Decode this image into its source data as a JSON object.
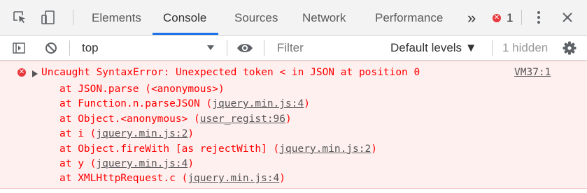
{
  "colors": {
    "accent": "#1a73e8",
    "error_text": "#ff0000",
    "error_bg": "#fff0f0",
    "error_badge": "#e8383d"
  },
  "tabs": [
    {
      "label": "Elements",
      "active": false
    },
    {
      "label": "Console",
      "active": true
    },
    {
      "label": "Sources",
      "active": false
    },
    {
      "label": "Network",
      "active": false
    },
    {
      "label": "Performance",
      "active": false
    }
  ],
  "tabbar": {
    "more_tabs_label": "»",
    "error_count": "1",
    "icons": [
      "inspect-element-icon",
      "device-toolbar-icon",
      "error-count-icon",
      "kebab-menu-icon",
      "close-icon"
    ]
  },
  "toolbar": {
    "context": "top",
    "filter_placeholder": "Filter",
    "levels_label": "Default levels ▼",
    "hidden_label": "1 hidden",
    "icons": [
      "sidebar-toggle-icon",
      "clear-console-icon",
      "dropdown-arrow-icon",
      "eye-icon",
      "settings-gear-icon"
    ]
  },
  "console": {
    "message": "Uncaught SyntaxError: Unexpected token < in JSON at position 0",
    "source": "VM37:1",
    "stack": [
      {
        "prefix": "at JSON.parse (<anonymous>)",
        "link": "",
        "suffix": ""
      },
      {
        "prefix": "at Function.n.parseJSON (",
        "link": "jquery.min.js:4",
        "suffix": ")"
      },
      {
        "prefix": "at Object.<anonymous> (",
        "link": "user_regist:96",
        "suffix": ")"
      },
      {
        "prefix": "at i (",
        "link": "jquery.min.js:2",
        "suffix": ")"
      },
      {
        "prefix": "at Object.fireWith [as rejectWith] (",
        "link": "jquery.min.js:2",
        "suffix": ")"
      },
      {
        "prefix": "at y (",
        "link": "jquery.min.js:4",
        "suffix": ")"
      },
      {
        "prefix": "at XMLHttpRequest.c (",
        "link": "jquery.min.js:4",
        "suffix": ")"
      }
    ]
  }
}
